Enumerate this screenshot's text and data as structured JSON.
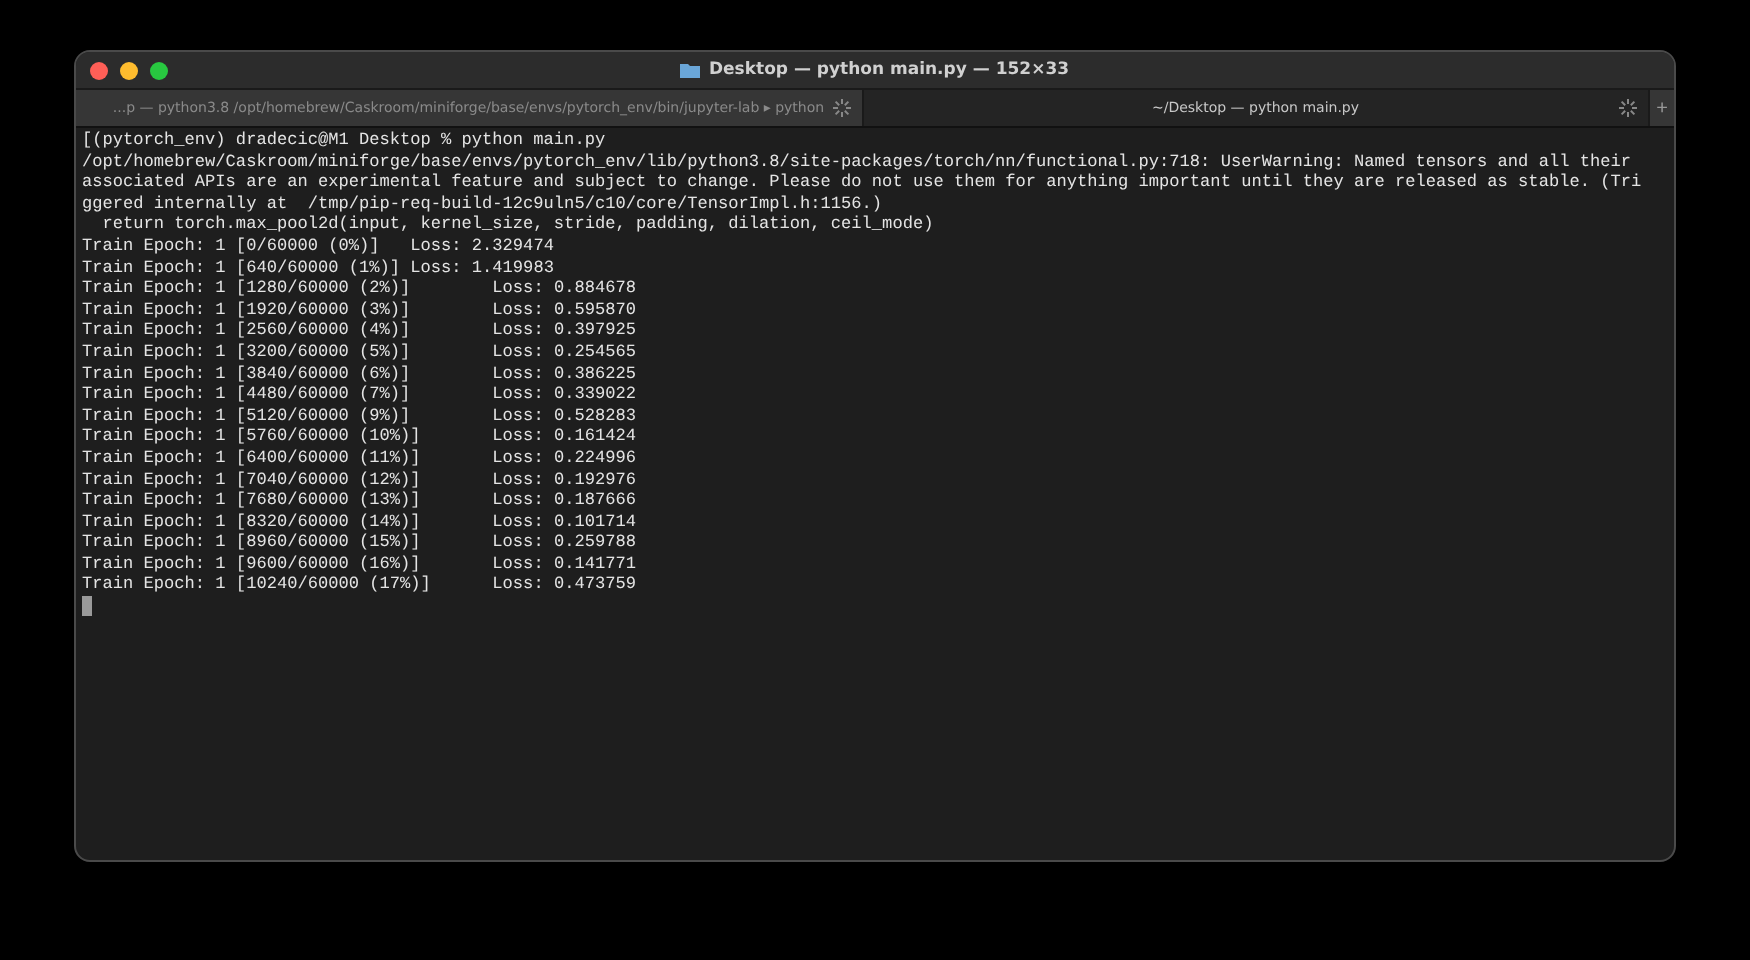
{
  "window": {
    "title": "Desktop — python main.py — 152×33"
  },
  "tabs": [
    {
      "label": "...p — python3.8 /opt/homebrew/Caskroom/miniforge/base/envs/pytorch_env/bin/jupyter-lab ▸ python",
      "selected": false,
      "busy": true
    },
    {
      "label": "~/Desktop — python main.py",
      "selected": true,
      "busy": true
    }
  ],
  "new_tab_button": "+",
  "terminal": {
    "lines": [
      "[(pytorch_env) dradecic@M1 Desktop % python main.py",
      "/opt/homebrew/Caskroom/miniforge/base/envs/pytorch_env/lib/python3.8/site-packages/torch/nn/functional.py:718: UserWarning: Named tensors and all their",
      "associated APIs are an experimental feature and subject to change. Please do not use them for anything important until they are released as stable. (Tri",
      "ggered internally at  /tmp/pip-req-build-12c9uln5/c10/core/TensorImpl.h:1156.)",
      "  return torch.max_pool2d(input, kernel_size, stride, padding, dilation, ceil_mode)",
      "Train Epoch: 1 [0/60000 (0%)]\tLoss: 2.329474",
      "Train Epoch: 1 [640/60000 (1%)]\tLoss: 1.419983",
      "Train Epoch: 1 [1280/60000 (2%)]\tLoss: 0.884678",
      "Train Epoch: 1 [1920/60000 (3%)]\tLoss: 0.595870",
      "Train Epoch: 1 [2560/60000 (4%)]\tLoss: 0.397925",
      "Train Epoch: 1 [3200/60000 (5%)]\tLoss: 0.254565",
      "Train Epoch: 1 [3840/60000 (6%)]\tLoss: 0.386225",
      "Train Epoch: 1 [4480/60000 (7%)]\tLoss: 0.339022",
      "Train Epoch: 1 [5120/60000 (9%)]\tLoss: 0.528283",
      "Train Epoch: 1 [5760/60000 (10%)]\tLoss: 0.161424",
      "Train Epoch: 1 [6400/60000 (11%)]\tLoss: 0.224996",
      "Train Epoch: 1 [7040/60000 (12%)]\tLoss: 0.192976",
      "Train Epoch: 1 [7680/60000 (13%)]\tLoss: 0.187666",
      "Train Epoch: 1 [8320/60000 (14%)]\tLoss: 0.101714",
      "Train Epoch: 1 [8960/60000 (15%)]\tLoss: 0.259788",
      "Train Epoch: 1 [9600/60000 (16%)]\tLoss: 0.141771",
      "Train Epoch: 1 [10240/60000 (17%)]\tLoss: 0.473759"
    ]
  }
}
